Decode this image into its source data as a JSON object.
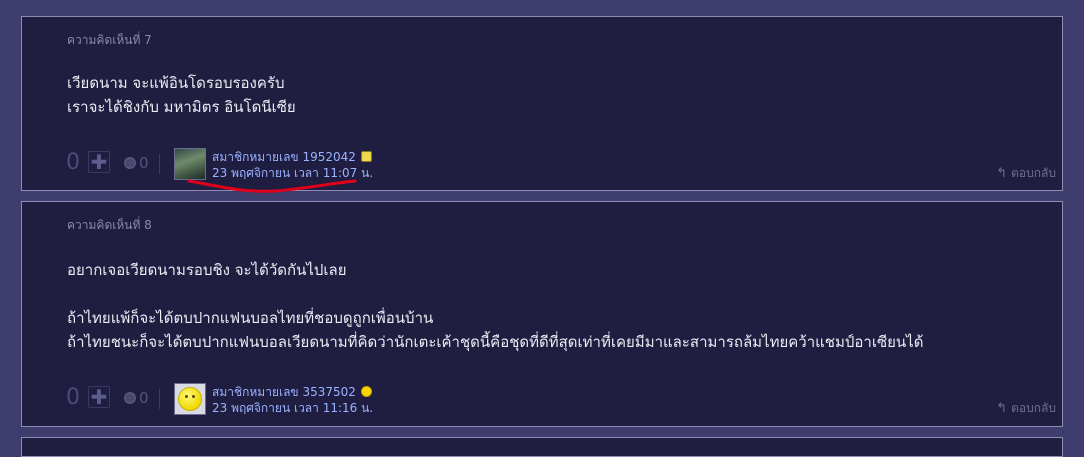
{
  "comments": [
    {
      "title": "ความคิดเห็นที่ 7",
      "lines": [
        "เวียดนาม จะแพ้อินโดรอบรองครับ",
        "เราจะได้ชิงกับ มหามิตร อินโดนีเซีย"
      ],
      "vote_count": "0",
      "plus": "✚",
      "emotion_count": "0",
      "member": "สมาชิกหมายเลข 1952042",
      "time": "23 พฤศจิกายน เวลา 11:07 น.",
      "reply": "ตอบกลับ"
    },
    {
      "title": "ความคิดเห็นที่ 8",
      "lines": [
        "อยากเจอเวียดนามรอบชิง จะได้วัดกันไปเลย",
        "",
        "ถ้าไทยแพ้ก็จะได้ตบปากแฟนบอลไทยที่ชอบดูถูกเพื่อนบ้าน",
        "ถ้าไทยชนะก็จะได้ตบปากแฟนบอลเวียดนามที่คิดว่านักเตะเค้าชุดนี้คือชุดที่ดีที่สุดเท่าที่เคยมีมาและสามารถล้มไทยคว้าแชมป์อาเซียนได้"
      ],
      "vote_count": "0",
      "plus": "✚",
      "emotion_count": "0",
      "member": "สมาชิกหมายเลข 3537502",
      "time": "23 พฤศจิกายน เวลา 11:16 น.",
      "reply": "ตอบกลับ"
    }
  ],
  "icons": {
    "reply": "reply-arrow-icon",
    "emotion": "emotion-face-icon",
    "plus": "plus-icon"
  },
  "colors": {
    "page_bg": "#3f3d6e",
    "card_bg": "#1f1e40",
    "link": "#9bb2ff",
    "annotation": "#e0001a"
  }
}
